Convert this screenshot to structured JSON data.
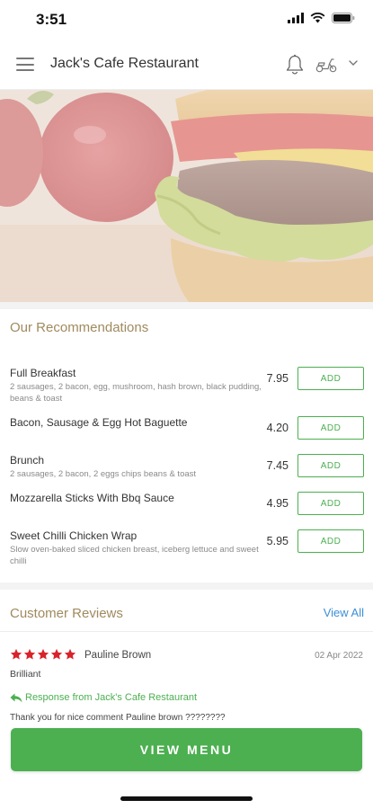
{
  "status_bar": {
    "time": "3:51"
  },
  "header": {
    "title": "Jack's Cafe Restaurant"
  },
  "icons": {
    "menu": "hamburger-icon",
    "bell": "bell-icon",
    "delivery": "scooter-icon",
    "chevron": "chevron-down-icon",
    "star": "star-icon",
    "reply": "reply-arrow-icon"
  },
  "colors": {
    "accent_green": "#4caf50",
    "section_title": "#a08a5e",
    "link_blue": "#3d8fd6",
    "star_red": "#d9232b"
  },
  "recommendations": {
    "title": "Our Recommendations",
    "items": [
      {
        "name": "Full Breakfast",
        "description": "2 sausages, 2 bacon, egg, mushroom, hash brown, black pudding, beans & toast",
        "price": "7.95",
        "button": "ADD"
      },
      {
        "name": "Bacon, Sausage & Egg Hot Baguette",
        "description": "",
        "price": "4.20",
        "button": "ADD"
      },
      {
        "name": "Brunch",
        "description": "2 sausages, 2 bacon, 2 eggs chips beans & toast",
        "price": "7.45",
        "button": "ADD"
      },
      {
        "name": "Mozzarella Sticks With Bbq Sauce",
        "description": "",
        "price": "4.95",
        "button": "ADD"
      },
      {
        "name": "Sweet Chilli Chicken Wrap",
        "description": "Slow oven-baked sliced chicken breast, iceberg lettuce and sweet chilli",
        "price": "5.95",
        "button": "ADD"
      }
    ]
  },
  "reviews": {
    "title": "Customer Reviews",
    "view_all": "View All",
    "items": [
      {
        "rating": 5,
        "author": "Pauline Brown",
        "date": "02 Apr 2022",
        "text": "Brilliant",
        "response_label": "Response from Jack's Cafe Restaurant",
        "response_text": "Thank you for nice comment Pauline brown ????????"
      }
    ]
  },
  "cta": {
    "label": "VIEW MENU"
  }
}
